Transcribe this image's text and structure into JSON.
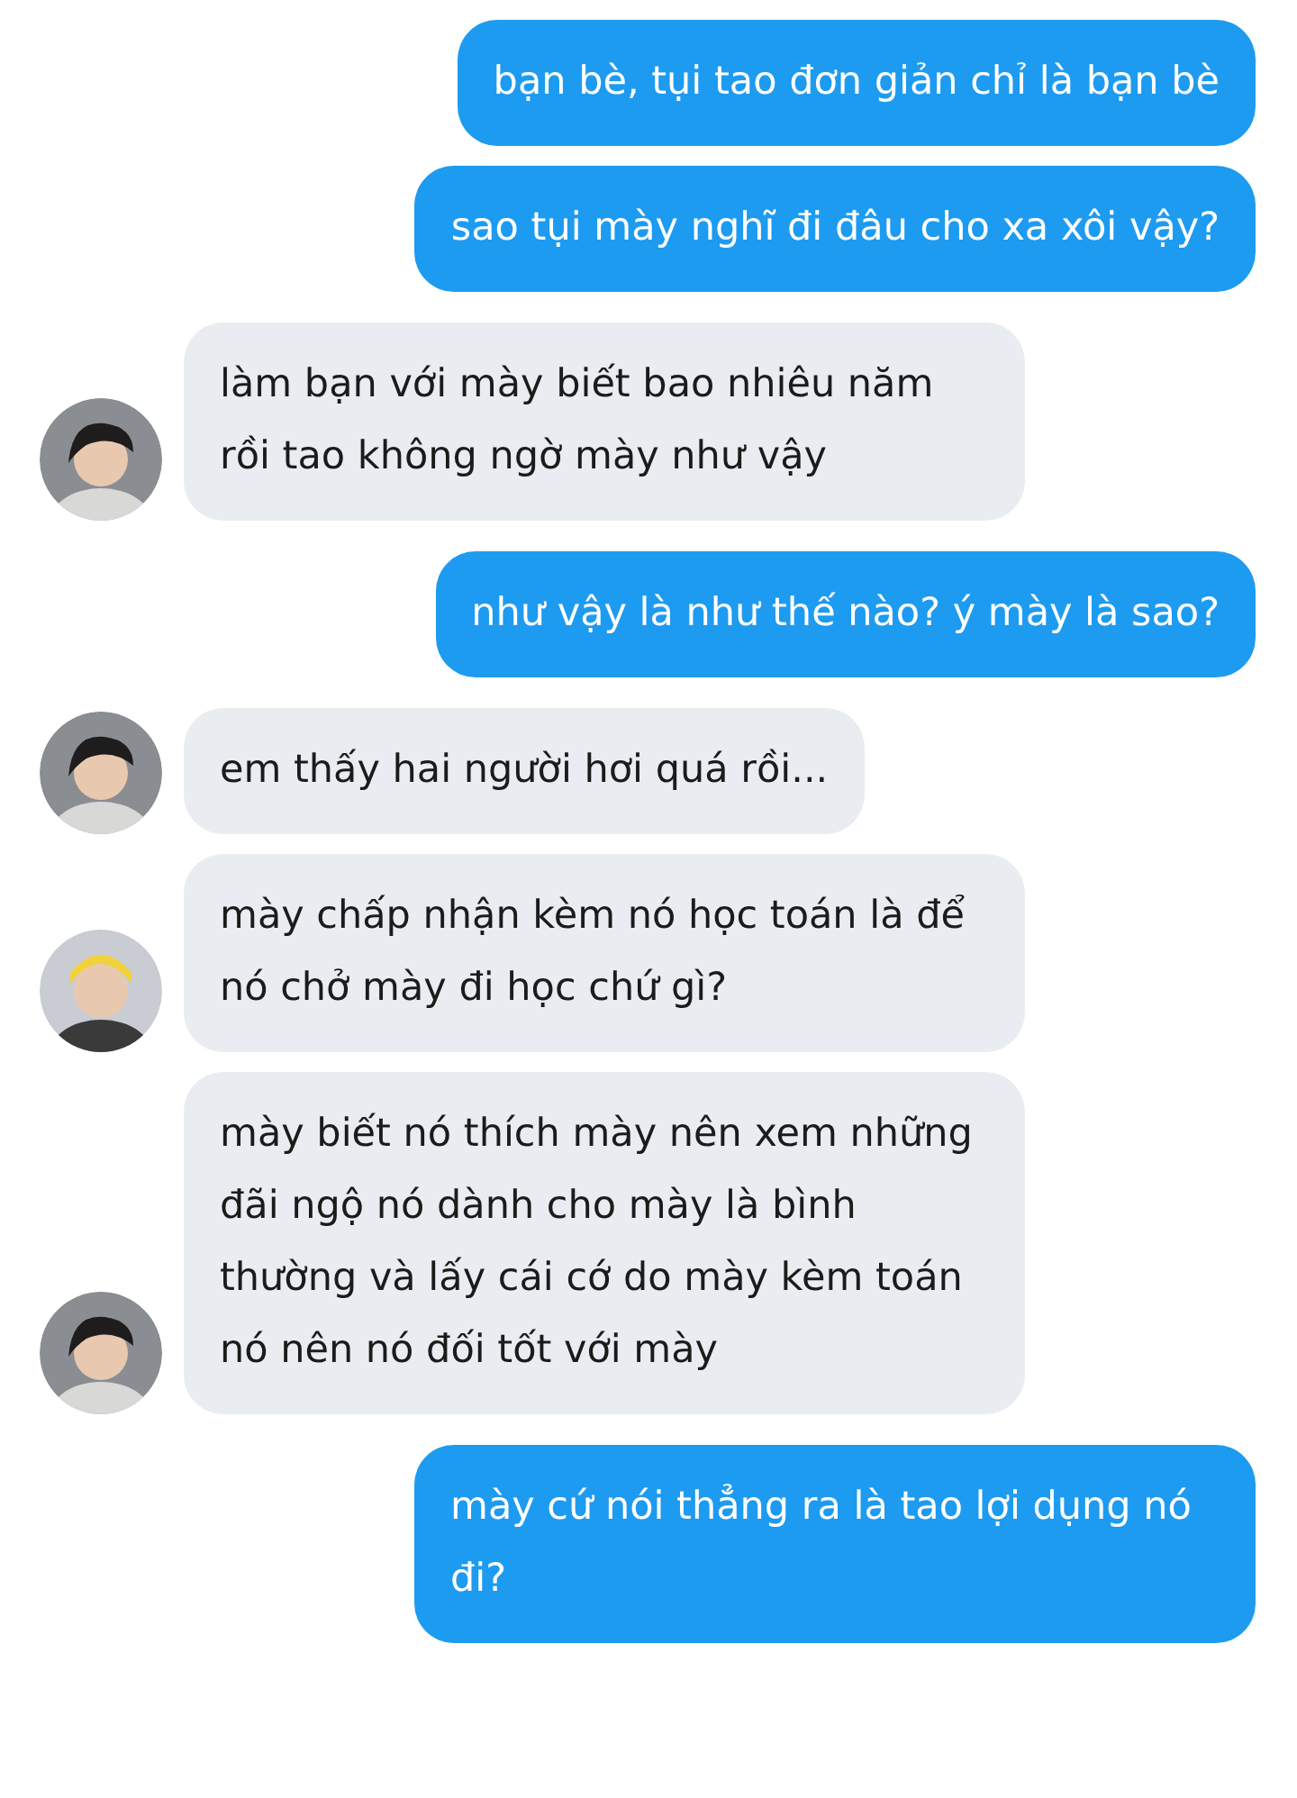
{
  "messages": [
    {
      "kind": "outgoing",
      "text": "bạn bè, tụi tao đơn giản chỉ là bạn bè"
    },
    {
      "kind": "outgoing",
      "text": "sao tụi mày nghĩ đi đâu cho xa xôi vậy?"
    },
    {
      "kind": "incoming",
      "text": "làm bạn với mày biết bao nhiêu năm rồi tao không ngờ mày như vậy"
    },
    {
      "kind": "outgoing",
      "text": "như vậy là như thế nào? ý mày là sao?"
    },
    {
      "kind": "incoming",
      "text": "em thấy hai người hơi quá rồi..."
    },
    {
      "kind": "incoming",
      "text": "mày chấp nhận kèm nó học toán là để nó chở mày đi học chứ gì?"
    },
    {
      "kind": "incoming",
      "text": "mày biết nó thích mày nên xem những đãi ngộ nó dành cho mày là bình thường và lấy cái cớ do mày kèm toán nó nên nó đối tốt với mày"
    },
    {
      "kind": "outgoing",
      "text": "mày cứ nói thẳng ra là tao lợi dụng nó đi?"
    }
  ]
}
